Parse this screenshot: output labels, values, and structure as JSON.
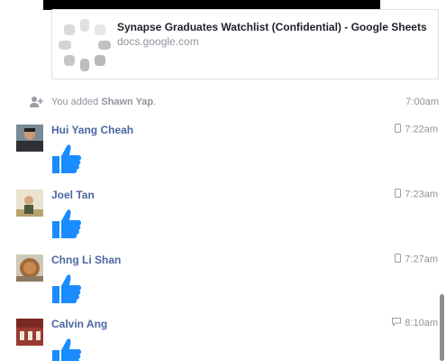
{
  "link_preview": {
    "title": "Synapse Graduates Watchlist (Confidential) - Google Sheets",
    "domain": "docs.google.com"
  },
  "system_event": {
    "icon": "add-person-icon",
    "prefix": "You added ",
    "name": "Shawn Yap",
    "suffix": ".",
    "time": "7:00am"
  },
  "messages": [
    {
      "sender": "Hui Yang Cheah",
      "time": "7:22am",
      "device": "mobile-icon",
      "content": "like-sticker"
    },
    {
      "sender": "Joel Tan",
      "time": "7:23am",
      "device": "mobile-icon",
      "content": "like-sticker"
    },
    {
      "sender": "Chng Li Shan",
      "time": "7:27am",
      "device": "mobile-icon",
      "content": "like-sticker"
    },
    {
      "sender": "Calvin Ang",
      "time": "8:10am",
      "device": "chat-icon",
      "content": "like-sticker"
    }
  ],
  "colors": {
    "sender_name": "#4b67a1",
    "muted_text": "#90949c",
    "like_blue": "#1a8cff"
  }
}
